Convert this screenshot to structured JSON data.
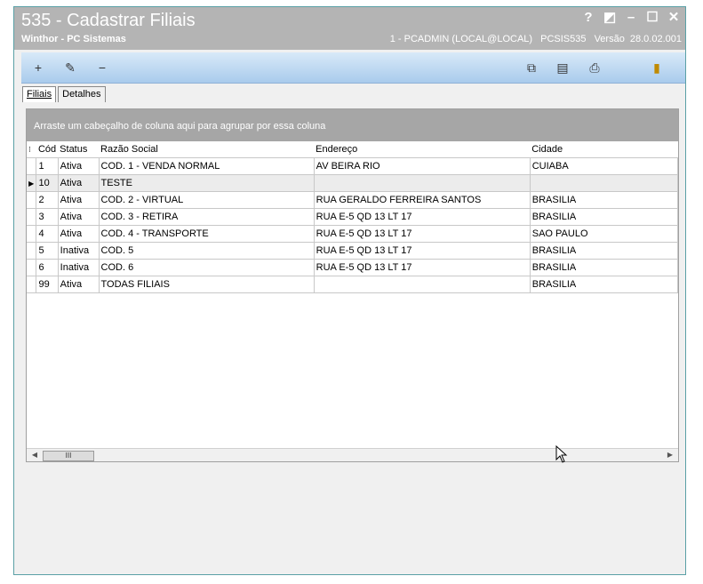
{
  "window": {
    "title": "535 - Cadastrar Filiais",
    "subtitle": "Winthor - PC Sistemas",
    "user": "1 - PCADMIN (LOCAL@LOCAL)",
    "program": "PCSIS535",
    "version_label": "Versão",
    "version": "28.0.02.001",
    "buttons": {
      "help": "?",
      "restore_alt": "◩",
      "minimize": "–",
      "maximize": "☐",
      "close": "✕"
    }
  },
  "toolbar": {
    "icons": [
      "add-icon",
      "edit-icon",
      "remove-icon",
      "copy-icon",
      "report-icon",
      "print-icon",
      "exit-icon"
    ],
    "add": "+",
    "edit": "✎",
    "remove": "−",
    "copy": "⧉",
    "report": "▤",
    "print": "⎙",
    "exit": "▮"
  },
  "tabs": [
    {
      "label": "Filiais",
      "active": true
    },
    {
      "label": "Detalhes",
      "active": false
    }
  ],
  "grid": {
    "group_hint": "Arraste um cabeçalho de coluna aqui para agrupar por essa coluna",
    "columns": [
      "Cód",
      "Status",
      "Razão Social",
      "Endereço",
      "Cidade"
    ],
    "rows": [
      {
        "cod": "1",
        "status": "Ativa",
        "razao": "COD. 1 - VENDA NORMAL",
        "endereco": "AV BEIRA RIO",
        "cidade": "CUIABA"
      },
      {
        "cod": "10",
        "status": "Ativa",
        "razao": "TESTE",
        "endereco": "",
        "cidade": "",
        "selected": true
      },
      {
        "cod": "2",
        "status": "Ativa",
        "razao": "COD. 2 - VIRTUAL",
        "endereco": "RUA GERALDO FERREIRA SANTOS",
        "cidade": "BRASILIA"
      },
      {
        "cod": "3",
        "status": "Ativa",
        "razao": "COD. 3 - RETIRA",
        "endereco": "RUA E-5 QD 13 LT 17",
        "cidade": "BRASILIA"
      },
      {
        "cod": "4",
        "status": "Ativa",
        "razao": "COD. 4 - TRANSPORTE",
        "endereco": "RUA E-5 QD 13 LT 17",
        "cidade": "SAO PAULO"
      },
      {
        "cod": "5",
        "status": "Inativa",
        "razao": "COD. 5",
        "endereco": "RUA E-5 QD 13 LT 17",
        "cidade": "BRASILIA"
      },
      {
        "cod": "6",
        "status": "Inativa",
        "razao": "COD. 6",
        "endereco": "RUA E-5 QD 13 LT 17",
        "cidade": "BRASILIA"
      },
      {
        "cod": "99",
        "status": "Ativa",
        "razao": "TODAS FILIAIS",
        "endereco": "",
        "cidade": "BRASILIA"
      }
    ],
    "scroll": {
      "left": "◀",
      "right": "▶",
      "thumb": "III"
    }
  },
  "colors": {
    "titlebar": "#b4b4b4",
    "toolbar": "#a9cbec",
    "grouppanel": "#a6a6a6"
  }
}
